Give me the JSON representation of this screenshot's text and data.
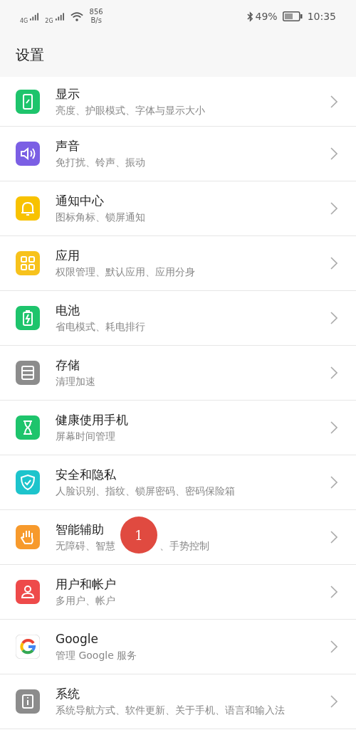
{
  "status_bar": {
    "signal_1": "4G",
    "signal_2": "2G",
    "speed": "856",
    "speed_unit": "B/s",
    "battery_percent": "49%",
    "time": "10:35"
  },
  "title": "设置",
  "items": [
    {
      "kind": "display",
      "color": "#1ec46c",
      "title": "显示",
      "subtitle": "亮度、护眼模式、字体与显示大小"
    },
    {
      "kind": "sound",
      "color": "#7b5fe4",
      "title": "声音",
      "subtitle": "免打扰、铃声、振动"
    },
    {
      "kind": "bell",
      "color": "#f8c200",
      "title": "通知中心",
      "subtitle": "图标角标、锁屏通知"
    },
    {
      "kind": "apps",
      "color": "#f7c21c",
      "title": "应用",
      "subtitle": "权限管理、默认应用、应用分身"
    },
    {
      "kind": "battery",
      "color": "#1ec46c",
      "title": "电池",
      "subtitle": "省电模式、耗电排行"
    },
    {
      "kind": "storage",
      "color": "#8c8c8c",
      "title": "存储",
      "subtitle": "清理加速"
    },
    {
      "kind": "hourglass",
      "color": "#1ec46c",
      "title": "健康使用手机",
      "subtitle": "屏幕时间管理"
    },
    {
      "kind": "shield",
      "color": "#1dc4cc",
      "title": "安全和隐私",
      "subtitle": "人脸识别、指纹、锁屏密码、密码保险箱"
    },
    {
      "kind": "hand",
      "color": "#f79a2c",
      "title": "智能辅助",
      "subtitle": "无障碍、智慧",
      "subtitle_after": "、手势控制",
      "marker": "1"
    },
    {
      "kind": "user",
      "color": "#ee4a4a",
      "title": "用户和帐户",
      "subtitle": "多用户、帐户"
    },
    {
      "kind": "google",
      "title": "Google",
      "subtitle": "管理 Google 服务"
    },
    {
      "kind": "info",
      "color": "#8c8c8c",
      "title": "系统",
      "subtitle": "系统导航方式、软件更新、关于手机、语言和输入法"
    }
  ]
}
